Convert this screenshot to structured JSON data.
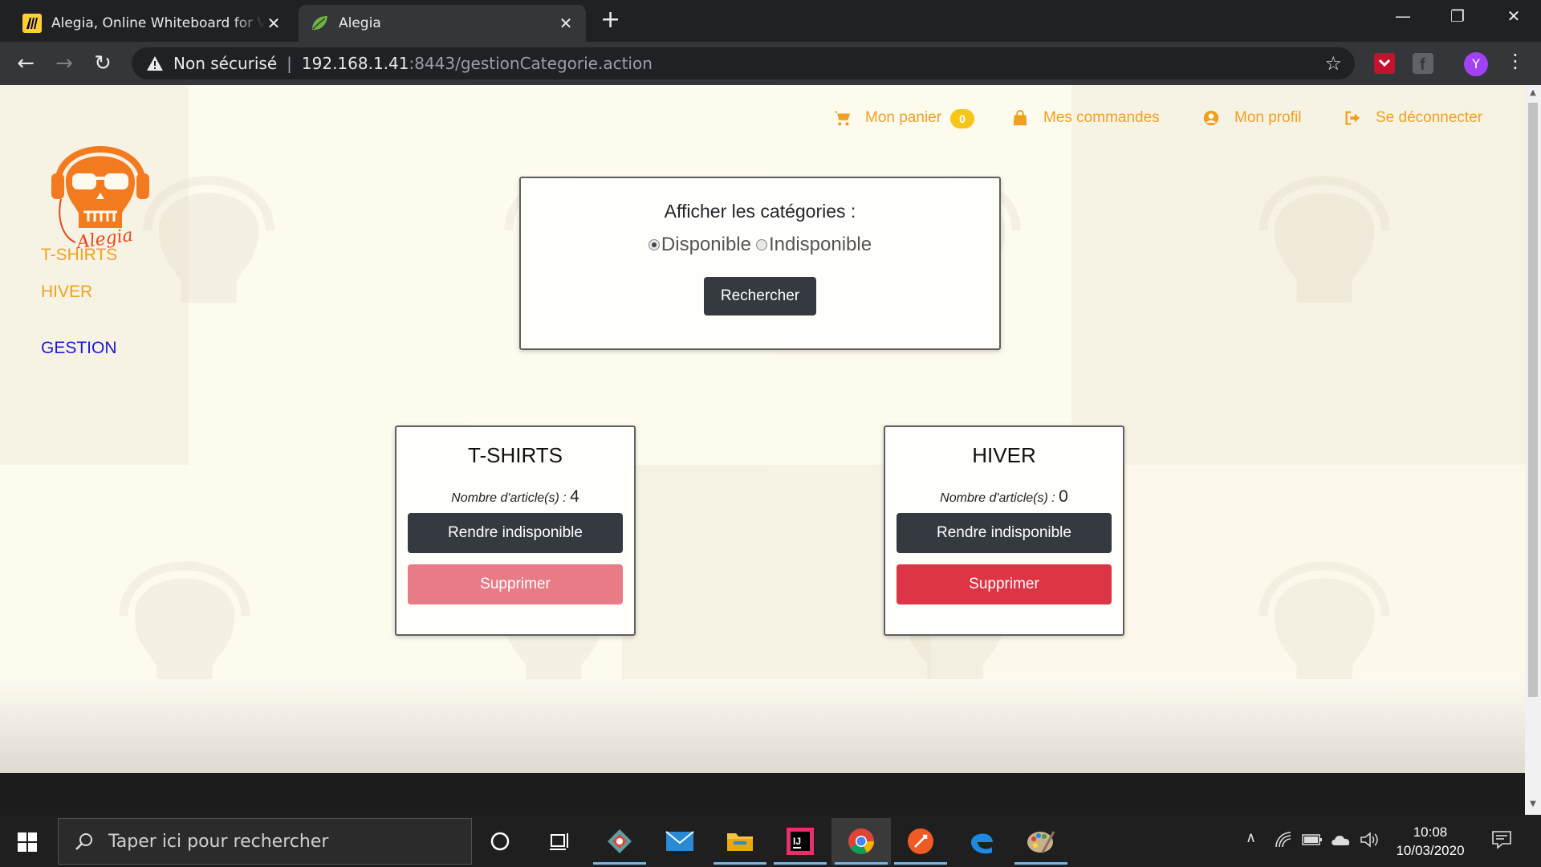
{
  "browser": {
    "tabs": [
      {
        "title": "Alegia, Online Whiteboard for Vis",
        "close": "✕",
        "favicon": "miro-icon"
      },
      {
        "title": "Alegia",
        "close": "✕",
        "favicon": "spring-leaf-icon"
      }
    ],
    "new_tab": "+",
    "security_label": "Non sécurisé",
    "url_host": "192.168.1.41",
    "url_rest": ":8443/gestionCategorie.action",
    "avatar_initial": "Y"
  },
  "header_nav": [
    {
      "label": "Mon panier",
      "icon": "cart-icon"
    },
    {
      "label": "Mes commandes",
      "icon": "shopping-bag-icon"
    },
    {
      "label": "Mon profil",
      "icon": "user-circle-icon"
    },
    {
      "label": "Se déconnecter",
      "icon": "sign-out-icon"
    }
  ],
  "cart_count": "0",
  "sidebar": {
    "categories": [
      "T-SHIRTS",
      "HIVER"
    ],
    "admin": "GESTION"
  },
  "filter": {
    "title": "Afficher les catégories :",
    "options": [
      {
        "label": "Disponible",
        "checked": true
      },
      {
        "label": "Indisponible",
        "checked": false
      }
    ],
    "button": "Rechercher"
  },
  "categories": [
    {
      "name": "T-SHIRTS",
      "count_label": "Nombre d'article(s) :",
      "count": "4",
      "toggle_label": "Rendre indisponible",
      "delete_label": "Supprimer",
      "delete_enabled": false
    },
    {
      "name": "HIVER",
      "count_label": "Nombre d'article(s) :",
      "count": "0",
      "toggle_label": "Rendre indisponible",
      "delete_label": "Supprimer",
      "delete_enabled": true
    }
  ],
  "taskbar": {
    "search_placeholder": "Taper ici pour rechercher",
    "time": "10:08",
    "date": "10/03/2020"
  },
  "colors": {
    "accent": "#f0a020",
    "admin_link": "#1a1ad8",
    "dark_button": "#343a40",
    "danger": "#dc3545"
  }
}
